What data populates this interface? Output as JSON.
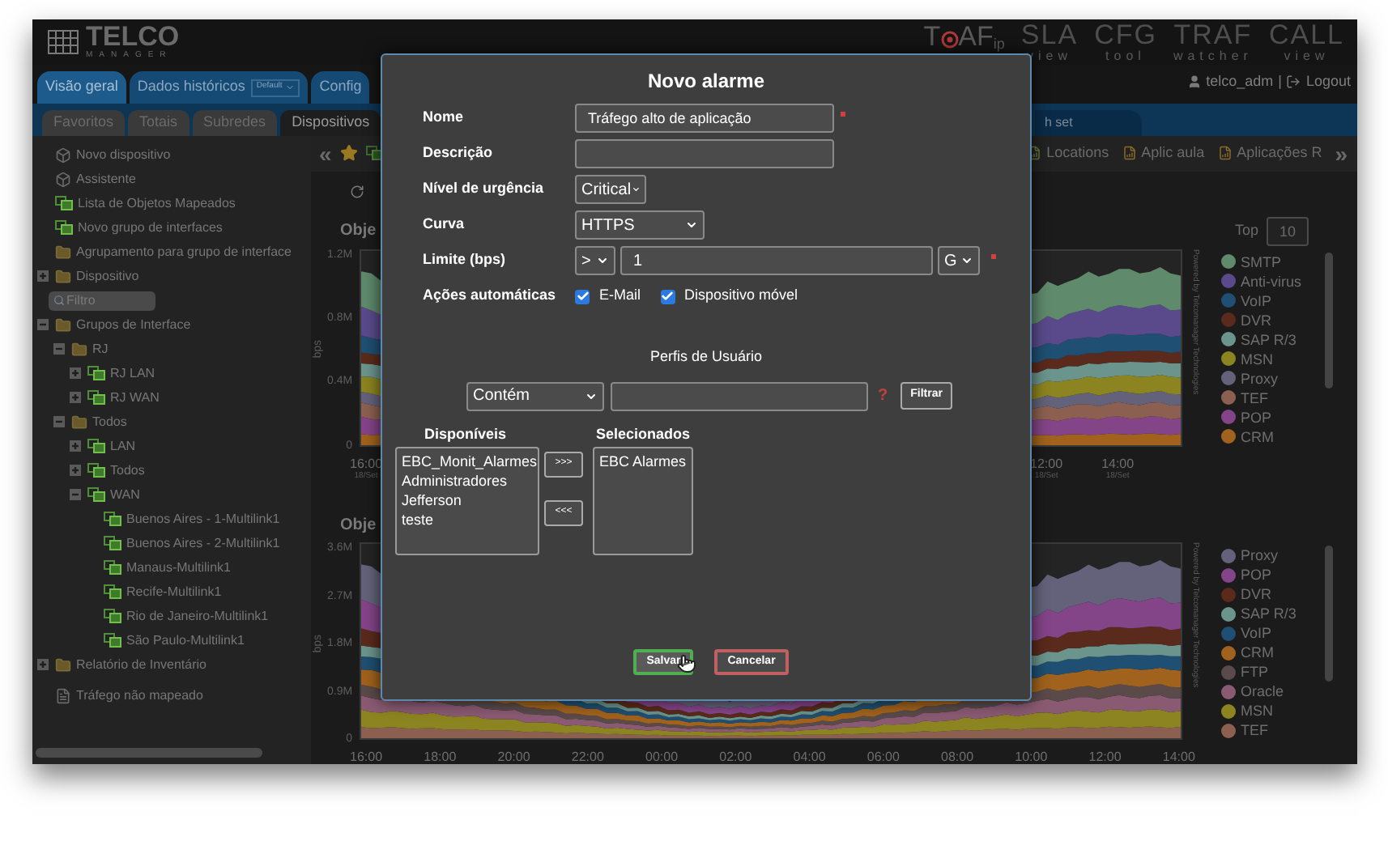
{
  "header": {
    "logo": {
      "name": "TELCO",
      "tagline": "MANAGER"
    },
    "products": [
      {
        "kind": "badge",
        "parts": [
          "T",
          "AF"
        ],
        "suffix": "ip"
      },
      {
        "kind": "plain",
        "name": "SLA",
        "tagline": "view"
      },
      {
        "kind": "plain",
        "name": "CFG",
        "tagline": "tool"
      },
      {
        "kind": "plain",
        "name": "TRAF",
        "tagline": "watcher"
      },
      {
        "kind": "plain",
        "name": "CALL",
        "tagline": "view"
      }
    ],
    "user": "telco_adm",
    "separator": "|",
    "logout": "Logout"
  },
  "nav": {
    "primary": [
      {
        "label": "Visão geral",
        "selected": true
      },
      {
        "label": "Dados históricos",
        "selected": false,
        "select": "Default"
      },
      {
        "label": "Config",
        "selected": false
      }
    ],
    "secondary": [
      {
        "label": "Favoritos",
        "selected": false
      },
      {
        "label": "Totais",
        "selected": false
      },
      {
        "label": "Subredes",
        "selected": false
      },
      {
        "label": "Dispositivos",
        "selected": true
      }
    ],
    "secondary_end": {
      "label": "h set",
      "selected": false
    }
  },
  "sidebar": {
    "items": [
      {
        "kind": "device",
        "label": "Novo dispositivo"
      },
      {
        "kind": "device",
        "label": "Assistente"
      },
      {
        "kind": "group",
        "label": "Lista de Objetos Mapeados"
      },
      {
        "kind": "group",
        "label": "Novo grupo de interfaces"
      },
      {
        "kind": "folder",
        "label": "Agrupamento para grupo de interface"
      },
      {
        "kind": "folder",
        "label": "Dispositivo",
        "expanded": false
      },
      {
        "kind": "filter",
        "placeholder": "Filtro"
      },
      {
        "kind": "folder",
        "label": "Grupos de Interface",
        "expanded": true,
        "children": [
          {
            "kind": "folder",
            "label": "RJ",
            "expanded": true,
            "children": [
              {
                "kind": "group",
                "label": "RJ LAN",
                "expanded": false
              },
              {
                "kind": "group",
                "label": "RJ WAN",
                "expanded": false
              }
            ]
          },
          {
            "kind": "folder",
            "label": "Todos",
            "expanded": true,
            "children": [
              {
                "kind": "group",
                "label": "LAN",
                "expanded": false
              },
              {
                "kind": "group",
                "label": "Todos",
                "expanded": false
              },
              {
                "kind": "group",
                "label": "WAN",
                "expanded": true,
                "children": [
                  {
                    "kind": "group",
                    "label": "Buenos Aires - 1-Multilink1"
                  },
                  {
                    "kind": "group",
                    "label": "Buenos Aires - 2-Multilink1"
                  },
                  {
                    "kind": "group",
                    "label": "Manaus-Multilink1"
                  },
                  {
                    "kind": "group",
                    "label": "Recife-Multilink1"
                  },
                  {
                    "kind": "group",
                    "label": "Rio de Janeiro-Multilink1"
                  },
                  {
                    "kind": "group",
                    "label": "São Paulo-Multilink1"
                  }
                ]
              }
            ]
          }
        ]
      },
      {
        "kind": "folder",
        "label": "Relatório de Inventário",
        "expanded": false
      },
      {
        "kind": "file",
        "label": "Tráfego não mapeado"
      }
    ]
  },
  "toolbar": {
    "collapse": "«",
    "end_items": [
      {
        "label": "Locations"
      },
      {
        "label": "Aplic aula"
      },
      {
        "label": "Aplicações R"
      }
    ],
    "more": "»"
  },
  "panels": [
    {
      "title": "Obje",
      "top_label": "Top",
      "top_value": "10",
      "ylabel": "bps",
      "yticks": [
        "1.2M",
        "0.8M",
        "0.4M",
        "0"
      ],
      "x_left": [
        {
          "time": "16:00",
          "date": "18/Set"
        }
      ],
      "x_right": [
        {
          "time": "12:00",
          "date": "18/Set"
        },
        {
          "time": "14:00",
          "date": "18/Set"
        }
      ],
      "credit": "Powered by Telcomanager Technologies",
      "legend": [
        {
          "label": "SMTP",
          "color": "#5f8a6c"
        },
        {
          "label": "Anti-virus",
          "color": "#5a4a8c"
        },
        {
          "label": "VoIP",
          "color": "#1f4f72"
        },
        {
          "label": "DVR",
          "color": "#5a2a1c"
        },
        {
          "label": "SAP R/3",
          "color": "#6a948c"
        },
        {
          "label": "MSN",
          "color": "#8c8420"
        },
        {
          "label": "Proxy",
          "color": "#64627a"
        },
        {
          "label": "TEF",
          "color": "#8c6050"
        },
        {
          "label": "POP",
          "color": "#844488"
        },
        {
          "label": "CRM",
          "color": "#a0621c"
        }
      ]
    },
    {
      "title": "Obje",
      "ylabel": "bps",
      "yticks": [
        "3.6M",
        "2.7M",
        "1.8M",
        "0.9M",
        "0"
      ],
      "x_left": [
        {
          "time": "16:00"
        },
        {
          "time": "18:00"
        },
        {
          "time": "20:00"
        },
        {
          "time": "22:00"
        },
        {
          "time": "00:00"
        },
        {
          "time": "02:00"
        },
        {
          "time": "04:00"
        },
        {
          "time": "06:00"
        },
        {
          "time": "08:00"
        },
        {
          "time": "10:00"
        },
        {
          "time": "12:00"
        },
        {
          "time": "14:00"
        }
      ],
      "credit": "Powered by Telcomanager Technologies",
      "legend": [
        {
          "label": "Proxy",
          "color": "#64627a"
        },
        {
          "label": "POP",
          "color": "#844488"
        },
        {
          "label": "DVR",
          "color": "#5a2a1c"
        },
        {
          "label": "SAP R/3",
          "color": "#6a948c"
        },
        {
          "label": "VoIP",
          "color": "#1f4f72"
        },
        {
          "label": "CRM",
          "color": "#a0621c"
        },
        {
          "label": "FTP",
          "color": "#5a4a4a"
        },
        {
          "label": "Oracle",
          "color": "#8a5a72"
        },
        {
          "label": "MSN",
          "color": "#8c8420"
        },
        {
          "label": "TEF",
          "color": "#8c6050"
        }
      ]
    }
  ],
  "modal": {
    "title": "Novo alarme",
    "fields": [
      {
        "kind": "text",
        "label": "Nome",
        "value": "Tráfego alto de aplicação",
        "required": true
      },
      {
        "kind": "text",
        "label": "Descrição",
        "required": false
      },
      {
        "kind": "select",
        "label": "Nível de urgência",
        "value": "Critical"
      },
      {
        "kind": "select",
        "label": "Curva",
        "value": "HTTPS"
      },
      {
        "kind": "threshold",
        "label": "Limite (bps)",
        "operator": ">",
        "value": "1",
        "unit": "G",
        "required": true
      },
      {
        "kind": "checks",
        "label": "Ações automáticas",
        "options": [
          {
            "label": "E-Mail",
            "checked": true
          },
          {
            "label": "Dispositivo móvel",
            "checked": true
          }
        ]
      }
    ],
    "profiles": {
      "title": "Perfis de Usuário",
      "match": "Contém",
      "help": "?",
      "filter_button": "Filtrar",
      "available_title": "Disponíveis",
      "available": [
        "EBC_Monit_Alarmes",
        "Administradores",
        "Jefferson",
        "teste"
      ],
      "add_button": ">>>",
      "remove_button": "<<<",
      "selected_title": "Selecionados",
      "selected": [
        "EBC Alarmes"
      ]
    },
    "buttons": [
      {
        "kind": "confirm",
        "label": "Salvar"
      },
      {
        "kind": "cancel",
        "label": "Cancelar"
      }
    ]
  }
}
